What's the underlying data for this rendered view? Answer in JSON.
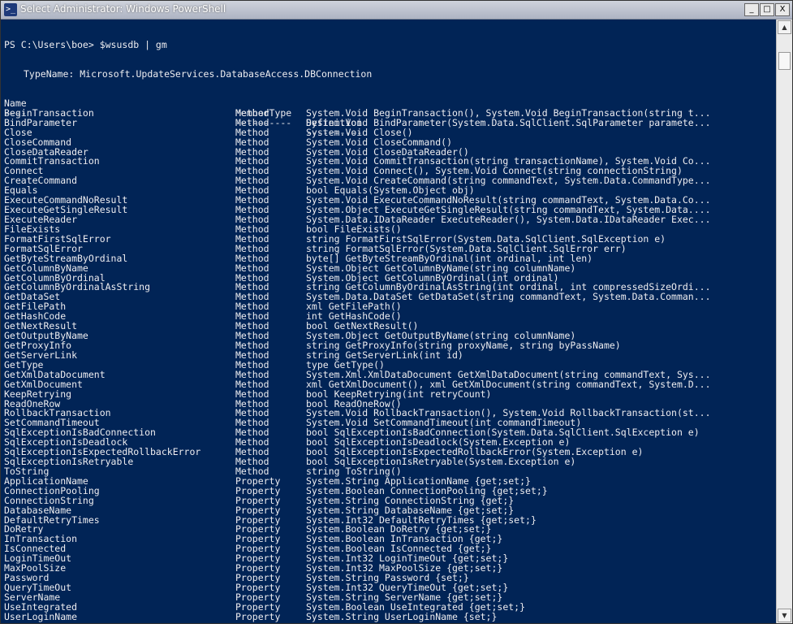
{
  "window": {
    "title": "Select Administrator: Windows PowerShell",
    "icon": "powershell-icon",
    "icon_glyph": ">_",
    "buttons": {
      "minimize": "_",
      "maximize": "□",
      "close": "X"
    }
  },
  "console": {
    "prompt": "PS C:\\Users\\boe> $wsusdb | gm",
    "typename": "TypeName: Microsoft.UpdateServices.DatabaseAccess.DBConnection",
    "headers": [
      "Name",
      "MemberType",
      "Definition"
    ],
    "underlines": [
      "----",
      "----------",
      "----------"
    ],
    "rows": [
      [
        "BeginTransaction",
        "Method",
        "System.Void BeginTransaction(), System.Void BeginTransaction(string t..."
      ],
      [
        "BindParameter",
        "Method",
        "System.Void BindParameter(System.Data.SqlClient.SqlParameter paramete..."
      ],
      [
        "Close",
        "Method",
        "System.Void Close()"
      ],
      [
        "CloseCommand",
        "Method",
        "System.Void CloseCommand()"
      ],
      [
        "CloseDataReader",
        "Method",
        "System.Void CloseDataReader()"
      ],
      [
        "CommitTransaction",
        "Method",
        "System.Void CommitTransaction(string transactionName), System.Void Co..."
      ],
      [
        "Connect",
        "Method",
        "System.Void Connect(), System.Void Connect(string connectionString)"
      ],
      [
        "CreateCommand",
        "Method",
        "System.Void CreateCommand(string commandText, System.Data.CommandType..."
      ],
      [
        "Equals",
        "Method",
        "bool Equals(System.Object obj)"
      ],
      [
        "ExecuteCommandNoResult",
        "Method",
        "System.Void ExecuteCommandNoResult(string commandText, System.Data.Co..."
      ],
      [
        "ExecuteGetSingleResult",
        "Method",
        "System.Object ExecuteGetSingleResult(string commandText, System.Data...."
      ],
      [
        "ExecuteReader",
        "Method",
        "System.Data.IDataReader ExecuteReader(), System.Data.IDataReader Exec..."
      ],
      [
        "FileExists",
        "Method",
        "bool FileExists()"
      ],
      [
        "FormatFirstSqlError",
        "Method",
        "string FormatFirstSqlError(System.Data.SqlClient.SqlException e)"
      ],
      [
        "FormatSqlError",
        "Method",
        "string FormatSqlError(System.Data.SqlClient.SqlError err)"
      ],
      [
        "GetByteStreamByOrdinal",
        "Method",
        "byte[] GetByteStreamByOrdinal(int ordinal, int len)"
      ],
      [
        "GetColumnByName",
        "Method",
        "System.Object GetColumnByName(string columnName)"
      ],
      [
        "GetColumnByOrdinal",
        "Method",
        "System.Object GetColumnByOrdinal(int ordinal)"
      ],
      [
        "GetColumnByOrdinalAsString",
        "Method",
        "string GetColumnByOrdinalAsString(int ordinal, int compressedSizeOrdi..."
      ],
      [
        "GetDataSet",
        "Method",
        "System.Data.DataSet GetDataSet(string commandText, System.Data.Comman..."
      ],
      [
        "GetFilePath",
        "Method",
        "xml GetFilePath()"
      ],
      [
        "GetHashCode",
        "Method",
        "int GetHashCode()"
      ],
      [
        "GetNextResult",
        "Method",
        "bool GetNextResult()"
      ],
      [
        "GetOutputByName",
        "Method",
        "System.Object GetOutputByName(string columnName)"
      ],
      [
        "GetProxyInfo",
        "Method",
        "string GetProxyInfo(string proxyName, string byPassName)"
      ],
      [
        "GetServerLink",
        "Method",
        "string GetServerLink(int id)"
      ],
      [
        "GetType",
        "Method",
        "type GetType()"
      ],
      [
        "GetXmlDataDocument",
        "Method",
        "System.Xml.XmlDataDocument GetXmlDataDocument(string commandText, Sys..."
      ],
      [
        "GetXmlDocument",
        "Method",
        "xml GetXmlDocument(), xml GetXmlDocument(string commandText, System.D..."
      ],
      [
        "KeepRetrying",
        "Method",
        "bool KeepRetrying(int retryCount)"
      ],
      [
        "ReadOneRow",
        "Method",
        "bool ReadOneRow()"
      ],
      [
        "RollbackTransaction",
        "Method",
        "System.Void RollbackTransaction(), System.Void RollbackTransaction(st..."
      ],
      [
        "SetCommandTimeout",
        "Method",
        "System.Void SetCommandTimeout(int commandTimeout)"
      ],
      [
        "SqlExceptionIsBadConnection",
        "Method",
        "bool SqlExceptionIsBadConnection(System.Data.SqlClient.SqlException e)"
      ],
      [
        "SqlExceptionIsDeadlock",
        "Method",
        "bool SqlExceptionIsDeadlock(System.Exception e)"
      ],
      [
        "SqlExceptionIsExpectedRollbackError",
        "Method",
        "bool SqlExceptionIsExpectedRollbackError(System.Exception e)"
      ],
      [
        "SqlExceptionIsRetryable",
        "Method",
        "bool SqlExceptionIsRetryable(System.Exception e)"
      ],
      [
        "ToString",
        "Method",
        "string ToString()"
      ],
      [
        "ApplicationName",
        "Property",
        "System.String ApplicationName {get;set;}"
      ],
      [
        "ConnectionPooling",
        "Property",
        "System.Boolean ConnectionPooling {get;set;}"
      ],
      [
        "ConnectionString",
        "Property",
        "System.String ConnectionString {get;}"
      ],
      [
        "DatabaseName",
        "Property",
        "System.String DatabaseName {get;set;}"
      ],
      [
        "DefaultRetryTimes",
        "Property",
        "System.Int32 DefaultRetryTimes {get;set;}"
      ],
      [
        "DoRetry",
        "Property",
        "System.Boolean DoRetry {get;set;}"
      ],
      [
        "InTransaction",
        "Property",
        "System.Boolean InTransaction {get;}"
      ],
      [
        "IsConnected",
        "Property",
        "System.Boolean IsConnected {get;}"
      ],
      [
        "LoginTimeOut",
        "Property",
        "System.Int32 LoginTimeOut {get;set;}"
      ],
      [
        "MaxPoolSize",
        "Property",
        "System.Int32 MaxPoolSize {get;set;}"
      ],
      [
        "Password",
        "Property",
        "System.String Password {set;}"
      ],
      [
        "QueryTimeOut",
        "Property",
        "System.Int32 QueryTimeOut {get;set;}"
      ],
      [
        "ServerName",
        "Property",
        "System.String ServerName {get;set;}"
      ],
      [
        "UseIntegrated",
        "Property",
        "System.Boolean UseIntegrated {get;set;}"
      ],
      [
        "UserLoginName",
        "Property",
        "System.String UserLoginName {set;}"
      ]
    ]
  },
  "scrollbar": {
    "up_icon": "scroll-up-icon",
    "down_icon": "scroll-down-icon",
    "up_glyph": "▲",
    "down_glyph": "▼"
  },
  "colors": {
    "console_bg": "#012456",
    "console_fg": "#eeedf0"
  }
}
